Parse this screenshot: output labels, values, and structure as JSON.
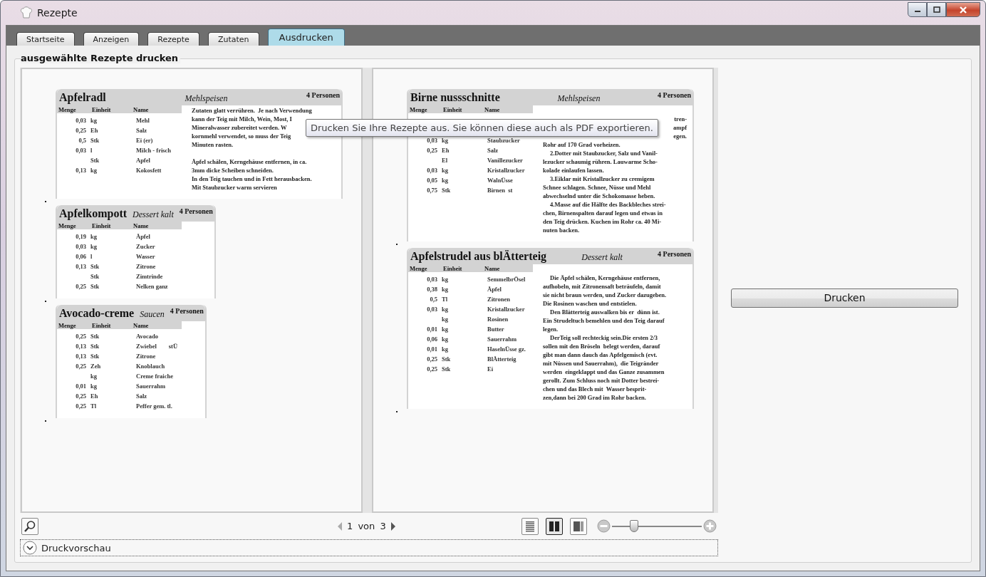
{
  "window": {
    "title": "Rezepte"
  },
  "tabs": [
    {
      "label": "Startseite",
      "selected": false
    },
    {
      "label": "Anzeigen",
      "selected": false
    },
    {
      "label": "Rezepte",
      "selected": false
    },
    {
      "label": "Zutaten",
      "selected": false
    },
    {
      "label": "Ausdrucken",
      "selected": true
    }
  ],
  "group": {
    "title": "ausgewählte Rezepte drucken"
  },
  "pages": [
    {
      "cards": [
        {
          "title": "Apfelradl",
          "category": "Mehlspeisen",
          "persons": "4 Personen",
          "columns": [
            "Menge",
            "Einheit",
            "Name"
          ],
          "ingredients": [
            {
              "amount": "0,03",
              "unit": "kg",
              "name": "Mehl"
            },
            {
              "amount": "0,25",
              "unit": "Eh",
              "name": "Salz"
            },
            {
              "amount": "0,5",
              "unit": "Stk",
              "name": "Ei (er)"
            },
            {
              "amount": "0,03",
              "unit": "l",
              "name": "Milch - frisch"
            },
            {
              "unit": "Stk",
              "name": "Apfel"
            },
            {
              "amount": "0,13",
              "unit": "kg",
              "name": "Kokosfett"
            }
          ],
          "description": [
            {
              "text": "Zutaten glatt verrühren.  Je nach Verwendung"
            },
            {
              "text": "kann der Teig mit Milch, Wein, Most, I"
            },
            {
              "text": "Mineralwasser zubereitet werden. W"
            },
            {
              "text": "kornmehl verwendet, so muss der Teig"
            },
            {
              "text": "Minuten rasten."
            },
            {
              "text": "Äpfel schälen, Kerngehäuse entfernen, in ca.",
              "space_before": true
            },
            {
              "text": "3mm dicke Scheiben schneiden."
            },
            {
              "text": "In den Teig tauchen und in Fett herausbacken."
            },
            {
              "text": "Mit Staubzucker warm servieren"
            }
          ]
        },
        {
          "title": "Apfelkompott",
          "category": "Dessert kalt",
          "persons": "4 Personen",
          "columns": [
            "Menge",
            "Einheit",
            "Name"
          ],
          "ingredients": [
            {
              "amount": "0,19",
              "unit": "kg",
              "name": "Äpfel"
            },
            {
              "amount": "0,03",
              "unit": "kg",
              "name": "Zucker"
            },
            {
              "amount": "0,06",
              "unit": "l",
              "name": "Wasser"
            },
            {
              "amount": "0,13",
              "unit": "Stk",
              "name": "Zitrone"
            },
            {
              "unit": "Stk",
              "name": "Zimtrinde"
            },
            {
              "amount": "0,25",
              "unit": "Stk",
              "name": "Nelken ganz"
            }
          ]
        },
        {
          "title": "Avocado-creme",
          "category": "Saucen",
          "persons": "4 Personen",
          "columns": [
            "Menge",
            "Einheit",
            "Name"
          ],
          "ingredients": [
            {
              "amount": "0,25",
              "unit": "Stk",
              "name": "Avocado"
            },
            {
              "amount": "0,13",
              "unit": "Stk",
              "name": "Zwiebel        stÜ"
            },
            {
              "amount": "0,13",
              "unit": "Stk",
              "name": "Zitrone"
            },
            {
              "amount": "0,25",
              "unit": "Zeh",
              "name": "Knoblauch"
            },
            {
              "unit": "kg",
              "name": "Creme fraiche"
            },
            {
              "amount": "0,01",
              "unit": "kg",
              "name": "Sauerrahm"
            },
            {
              "amount": "0,25",
              "unit": "Eh",
              "name": "Salz"
            },
            {
              "amount": "0,25",
              "unit": "Tl",
              "name": "Peffer gem. tl."
            }
          ]
        }
      ]
    },
    {
      "cards": [
        {
          "title": "Birne nussschnitte",
          "category": "Mehlspeisen",
          "persons": "4 Personen",
          "columns": [
            "Menge",
            "Einheit",
            "Name"
          ],
          "ingredients": [
            {
              "amount": "0,03",
              "unit": "kg",
              "name": "Staubzucker"
            },
            {
              "amount": "0,25",
              "unit": "Eh",
              "name": "Salz"
            },
            {
              "unit": "El",
              "name": "Vanillezucker"
            },
            {
              "amount": "0,03",
              "unit": "kg",
              "name": "Kristallzucker"
            },
            {
              "amount": "0,05",
              "unit": "kg",
              "name": "WalnÜsse"
            },
            {
              "amount": "0,75",
              "unit": "Stk",
              "name": "Birnen  st"
            }
          ],
          "description": [
            {
              "text": "tren-",
              "kind": "fragment",
              "space_before": true
            },
            {
              "text": "ampf",
              "kind": "fragment"
            },
            {
              "text": "egen.",
              "kind": "fragment"
            },
            {
              "text": "Rohr auf 170 Grad vorheizen."
            },
            {
              "text": "2.Dotter mit Staubzucker, Salz und Vanil-",
              "indent": true
            },
            {
              "text": "lezucker schaumig rühren. Lauwarme Scho-"
            },
            {
              "text": "kolade einlaufen lassen."
            },
            {
              "text": "3.Eiklar mit Kristallzucker zu cremigem",
              "indent": true
            },
            {
              "text": "Schnee schlagen. Schnee, Nüsse und Mehl"
            },
            {
              "text": "abwechselnd unter die Schokomasse heben."
            },
            {
              "text": "4.Masse auf die Hälfte des Backbleches strei-",
              "indent": true
            },
            {
              "text": "chen, Birnenspalten darauf legen und etwas in"
            },
            {
              "text": "den Teig drücken. Kuchen im Rohr ca. 40 Mi-"
            },
            {
              "text": "nuten backen."
            }
          ]
        },
        {
          "title": "Apfelstrudel aus blÄtterteig",
          "category": "Dessert kalt",
          "persons": "4 Personen",
          "columns": [
            "Menge",
            "Einheit",
            "Name"
          ],
          "ingredients": [
            {
              "amount": "0,03",
              "unit": "kg",
              "name": "SemmelbrÖsel"
            },
            {
              "amount": "0,38",
              "unit": "kg",
              "name": "Äpfel"
            },
            {
              "amount": "0,5",
              "unit": "Tl",
              "name": "Zitronen"
            },
            {
              "amount": "0,03",
              "unit": "kg",
              "name": "Kristallzucker"
            },
            {
              "unit": "kg",
              "name": "Rosinen"
            },
            {
              "amount": "0,01",
              "unit": "kg",
              "name": "Butter"
            },
            {
              "amount": "0,06",
              "unit": "kg",
              "name": "Sauerrahm"
            },
            {
              "amount": "0,01",
              "unit": "kg",
              "name": "HaselnÜsse gz."
            },
            {
              "amount": "0,25",
              "unit": "Stk",
              "name": "BlÄtterteig"
            },
            {
              "amount": "0,25",
              "unit": "Stk",
              "name": "Ei"
            }
          ],
          "description": [
            {
              "text": "Die Äpfel schälen, Kerngehäuse entfernen,",
              "indent": true,
              "space_before": true
            },
            {
              "text": "aufhobeln, mit Zitronensaft beträufeln, damit"
            },
            {
              "text": "sie nicht braun werden, und Zucker dazugeben."
            },
            {
              "text": "Die Rosinen waschen und entstielen."
            },
            {
              "text": "Den Blätterteig auswalken bis er  dünn ist.",
              "indent": true
            },
            {
              "text": "Ein Strudeltuch bemehlen und den Teig darauf"
            },
            {
              "text": "legen."
            },
            {
              "text": "DerTeig soll rechteckig sein.Die ersten 2/3",
              "indent": true
            },
            {
              "text": "sollen mit den Bröseln  belegt werden, darauf"
            },
            {
              "text": "gibt man dann dauch das Apfelgemisch (evt."
            },
            {
              "text": "mit Nüssen und Sauerrahm),  die Teigränder"
            },
            {
              "text": "werden  eingeklappt und das Ganze zusammen"
            },
            {
              "text": "gerollt. Zum Schluss noch mit Dotter bestrei-"
            },
            {
              "text": "chen und das Blech mit  Wasser besprit-"
            },
            {
              "text": "zen,dann bei 200 Grad im Rohr backen."
            }
          ]
        }
      ]
    }
  ],
  "tooltip": "Drucken Sie Ihre Rezepte aus. Sie können diese auch als PDF exportieren.",
  "pager": "1 von 3",
  "view_modes": [
    {
      "selected": false
    },
    {
      "selected": true
    },
    {
      "selected": false
    }
  ],
  "zoom": {
    "level": 0.22
  },
  "expander": {
    "label": "Druckvorschau",
    "expanded": false
  },
  "print_button": "Drucken"
}
